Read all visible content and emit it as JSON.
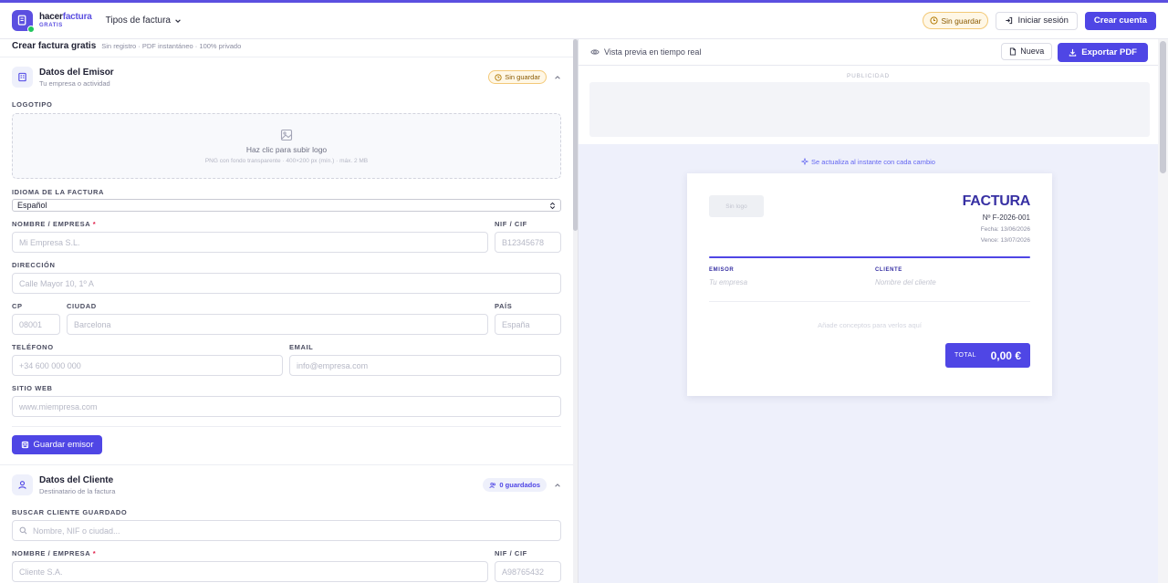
{
  "brand": {
    "name_a": "hacer",
    "name_b": "factura",
    "tagline": "GRATIS"
  },
  "nav": {
    "types_label": "Tipos de factura"
  },
  "top": {
    "status": "Sin guardar",
    "login": "Iniciar sesión",
    "signup": "Crear cuenta"
  },
  "page": {
    "title": "Crear factura gratis",
    "subtitle": "Sin registro · PDF instantáneo · 100% privado"
  },
  "issuer": {
    "title": "Datos del Emisor",
    "subtitle": "Tu empresa o actividad",
    "status": "Sin guardar",
    "logo_label": "LOGOTIPO",
    "upload_text": "Haz clic para subir logo",
    "upload_hint": "PNG con fondo transparente · 400×200 px (mín.) · máx. 2 MB",
    "language_label": "IDIOMA DE LA FACTURA",
    "language_value": "Español",
    "name_label": "NOMBRE / EMPRESA",
    "name_placeholder": "Mi Empresa S.L.",
    "nif_label": "NIF / CIF",
    "nif_placeholder": "B12345678",
    "address_label": "DIRECCIÓN",
    "address_placeholder": "Calle Mayor 10, 1º A",
    "cp_label": "CP",
    "cp_placeholder": "08001",
    "city_label": "CIUDAD",
    "city_placeholder": "Barcelona",
    "country_label": "PAÍS",
    "country_placeholder": "España",
    "phone_label": "TELÉFONO",
    "phone_placeholder": "+34 600 000 000",
    "email_label": "EMAIL",
    "email_placeholder": "info@empresa.com",
    "web_label": "SITIO WEB",
    "web_placeholder": "www.miempresa.com",
    "save_label": "Guardar emisor"
  },
  "client": {
    "title": "Datos del Cliente",
    "subtitle": "Destinatario de la factura",
    "saved_badge": "0  guardados",
    "search_label": "BUSCAR CLIENTE GUARDADO",
    "search_placeholder": "Nombre, NIF o ciudad...",
    "name_label": "NOMBRE / EMPRESA",
    "name_placeholder": "Cliente S.A.",
    "nif_label": "NIF / CIF",
    "nif_placeholder": "A98765432"
  },
  "preview": {
    "live_label": "Vista previa en tiempo real",
    "new_label": "Nueva",
    "export_label": "Exportar PDF",
    "ad_label": "PUBLICIDAD",
    "instant_note": "Se actualiza al instante con cada cambio"
  },
  "invoice": {
    "no_logo": "Sin logo",
    "title": "FACTURA",
    "number": "Nº F-2026-001",
    "date": "Fecha: 13/06/2026",
    "due": "Vence: 13/07/2026",
    "issuer_head": "EMISOR",
    "issuer_value": "Tu empresa",
    "client_head": "CLIENTE",
    "client_value": "Nombre del cliente",
    "empty_items": "Añade conceptos para verlos aquí",
    "total_label": "TOTAL",
    "total_value": "0,00 €"
  },
  "colors": {
    "accent": "#4f46e5",
    "warn_bg": "#fff7e6",
    "preview_bg": "#eef0fb"
  }
}
